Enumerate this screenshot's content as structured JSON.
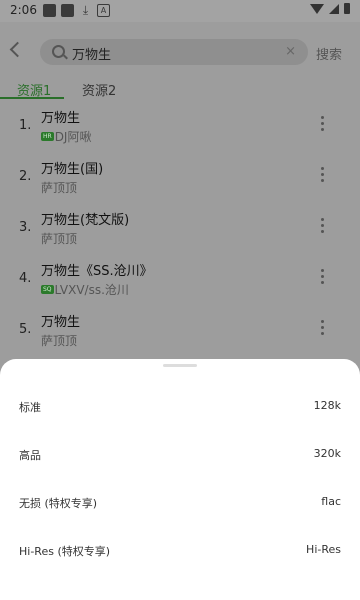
{
  "status_bar": {
    "time": "2:06",
    "a_icon": "A"
  },
  "search": {
    "query": "万物生",
    "clear_icon": "×",
    "action_label": "搜索"
  },
  "tabs": [
    {
      "label": "资源1"
    },
    {
      "label": "资源2"
    }
  ],
  "songs": [
    {
      "num": "1.",
      "title": "万物生",
      "badge": "HR",
      "artist": "DJ阿啾"
    },
    {
      "num": "2.",
      "title": "万物生(国)",
      "badge": "",
      "artist": "萨顶顶"
    },
    {
      "num": "3.",
      "title": "万物生(梵文版)",
      "badge": "",
      "artist": "萨顶顶"
    },
    {
      "num": "4.",
      "title": "万物生《SS.沧川》",
      "badge": "SQ",
      "artist": "LVXV/ss.沧川"
    },
    {
      "num": "5.",
      "title": "万物生",
      "badge": "",
      "artist": "萨顶顶"
    }
  ],
  "quality_sheet": {
    "options": [
      {
        "label": "标准",
        "value": "128k"
      },
      {
        "label": "高品",
        "value": "320k"
      },
      {
        "label": "无损 (特权专享)",
        "value": "flac"
      },
      {
        "label": "Hi-Res (特权专享)",
        "value": "Hi-Res"
      }
    ]
  },
  "colors": {
    "accent": "#2a6f2a",
    "sheet_bg": "#ffffff",
    "scrim": "#9d9d9d"
  }
}
